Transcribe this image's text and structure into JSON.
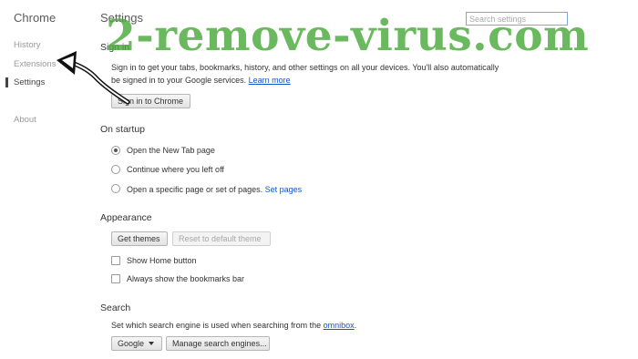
{
  "sidebar": {
    "title": "Chrome",
    "items": [
      {
        "label": "History"
      },
      {
        "label": "Extensions"
      },
      {
        "label": "Settings"
      },
      {
        "label": "About"
      }
    ]
  },
  "header": {
    "title": "Settings",
    "search_placeholder": "Search settings"
  },
  "signin": {
    "title": "Sign in",
    "description_line1": "Sign in to get your tabs, bookmarks, history, and other settings on all your devices. You'll also automatically",
    "description_line2": "be signed in to your Google services.",
    "learn_more": "Learn more",
    "button": "Sign in to Chrome"
  },
  "startup": {
    "title": "On startup",
    "options": [
      {
        "label": "Open the New Tab page",
        "selected": true
      },
      {
        "label": "Continue where you left off",
        "selected": false
      },
      {
        "label": "Open a specific page or set of pages.",
        "selected": false
      }
    ],
    "set_pages": "Set pages"
  },
  "appearance": {
    "title": "Appearance",
    "get_themes": "Get themes",
    "reset_theme": "Reset to default theme",
    "show_home": {
      "label": "Show Home button",
      "checked": false
    },
    "show_bookmarks": {
      "label": "Always show the bookmarks bar",
      "checked": false
    }
  },
  "search": {
    "title": "Search",
    "description": "Set which search engine is used when searching from the",
    "omnibox": "omnibox",
    "period": ".",
    "engine": "Google",
    "manage": "Manage search engines..."
  },
  "watermark": {
    "text": "2-remove-virus.com"
  },
  "colors": {
    "link": "#1155cc",
    "watermark": "#4aaa3a"
  }
}
